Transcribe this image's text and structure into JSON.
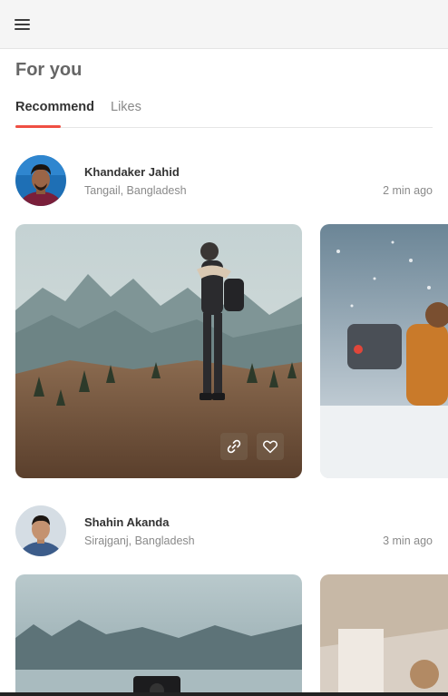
{
  "header": {
    "menu_icon": "hamburger-menu-icon"
  },
  "page": {
    "title": "For you"
  },
  "tabs": [
    {
      "label": "Recommend",
      "active": true
    },
    {
      "label": "Likes",
      "active": false
    }
  ],
  "accent_color": "#ef4f43",
  "posts": [
    {
      "author": "Khandaker Jahid",
      "location": "Tangail, Bangladesh",
      "time": "2 min ago",
      "actions": [
        "link-icon",
        "heart-icon"
      ]
    },
    {
      "author": "Shahin Akanda",
      "location": "Sirajganj, Bangladesh",
      "time": "3 min ago"
    }
  ]
}
